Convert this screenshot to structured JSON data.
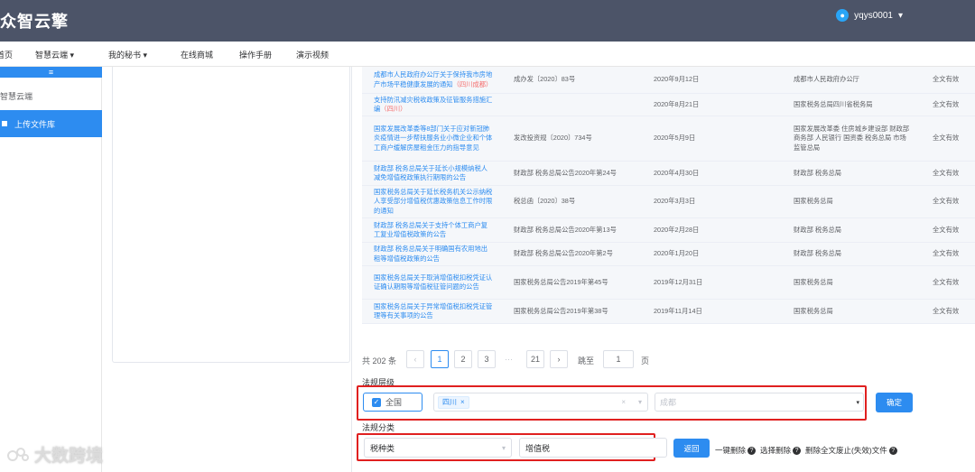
{
  "header": {
    "brand": "众智云擎",
    "username": "yqys0001",
    "user_caret": "▾"
  },
  "nav": {
    "items": [
      {
        "label": "首页"
      },
      {
        "label": "智慧云端",
        "caret": "▾"
      },
      {
        "label": "我的秘书",
        "caret": "▾"
      },
      {
        "label": "在线商城"
      },
      {
        "label": "操作手册"
      },
      {
        "label": "演示视频"
      }
    ]
  },
  "sidebar": {
    "toggle": "≡",
    "title": "智慧云端",
    "upload": "上传文件库"
  },
  "table": {
    "rows": [
      {
        "title_pre": "成都市人民政府办公厅关于保持我市房地产市场平稳健康发展的通知",
        "title_tag": "（四川成都）",
        "doc_no": "成办发〔2020〕83号",
        "date": "2020年9月12日",
        "issuer": "成都市人民政府办公厅",
        "status": "全文有效"
      },
      {
        "title_pre": "支持防汛减灾税收政策及征管服务措施汇编",
        "title_tag": "（四川）",
        "doc_no": "",
        "date": "2020年8月21日",
        "issuer": "国家税务总局四川省税务局",
        "status": "全文有效"
      },
      {
        "title_pre": "国家发展改革委等8部门关于应对新冠肺炎疫情进一步帮扶服务业小微企业和个体工商户缓解房屋租金压力的指导意见",
        "title_tag": "",
        "doc_no": "发改投资规〔2020〕734号",
        "date": "2020年5月9日",
        "issuer": "国家发展改革委 住房城乡建设部 财政部 商务部 人民银行 国资委 税务总局 市场监管总局",
        "status": "全文有效"
      },
      {
        "title_pre": "财政部 税务总局关于延长小规模纳税人减免增值税政策执行期限的公告",
        "title_tag": "",
        "doc_no": "财政部 税务总局公告2020年第24号",
        "date": "2020年4月30日",
        "issuer": "财政部 税务总局",
        "status": "全文有效"
      },
      {
        "title_pre": "国家税务总局关于延长税务机关公示纳税人享受部分增值税优惠政策信息工作时限的通知",
        "title_tag": "",
        "doc_no": "税总函〔2020〕38号",
        "date": "2020年3月3日",
        "issuer": "国家税务总局",
        "status": "全文有效"
      },
      {
        "title_pre": "财政部 税务总局关于支持个体工商户复工复业增值税政策的公告",
        "title_tag": "",
        "doc_no": "财政部 税务总局公告2020年第13号",
        "date": "2020年2月28日",
        "issuer": "财政部 税务总局",
        "status": "全文有效"
      },
      {
        "title_pre": "财政部 税务总局关于明确国有农用地出租等增值税政策的公告",
        "title_tag": "",
        "doc_no": "财政部 税务总局公告2020年第2号",
        "date": "2020年1月20日",
        "issuer": "财政部 税务总局",
        "status": "全文有效"
      },
      {
        "title_pre": "国家税务总局关于取消增值税扣税凭证认证确认期限等增值税征管问题的公告",
        "title_tag": "",
        "doc_no": "国家税务总局公告2019年第45号",
        "date": "2019年12月31日",
        "issuer": "国家税务总局",
        "status": "全文有效"
      },
      {
        "title_pre": "国家税务总局关于异常增值税扣税凭证管理等有关事项的公告",
        "title_tag": "",
        "doc_no": "国家税务总局公告2019年第38号",
        "date": "2019年11月14日",
        "issuer": "国家税务总局",
        "status": "全文有效"
      }
    ]
  },
  "pagination": {
    "total_text": "共 202 条",
    "prev": "‹",
    "next": "›",
    "pages": [
      "1",
      "2",
      "3"
    ],
    "ellipsis": "···",
    "last": "21",
    "jump_label": "跳至",
    "jump_value": "1",
    "page_unit": "页"
  },
  "filters": {
    "level_label": "法规层级",
    "national": "全国",
    "region_tag": "四川",
    "tag_close": "×",
    "clear": "×",
    "city_placeholder": "成都",
    "confirm": "确定",
    "category_label": "法规分类",
    "category_select": "税种类",
    "category_value": "增值税",
    "back": "返回",
    "delete_all": "一键删除",
    "delete_selected": "选择删除",
    "delete_obsolete": "删除全文废止(失效)文件",
    "help": "?"
  },
  "watermark": {
    "text": "大数跨境"
  },
  "colors": {
    "header_bg": "#4c5468",
    "primary": "#2d8cf0",
    "highlight_red": "#e02020"
  }
}
